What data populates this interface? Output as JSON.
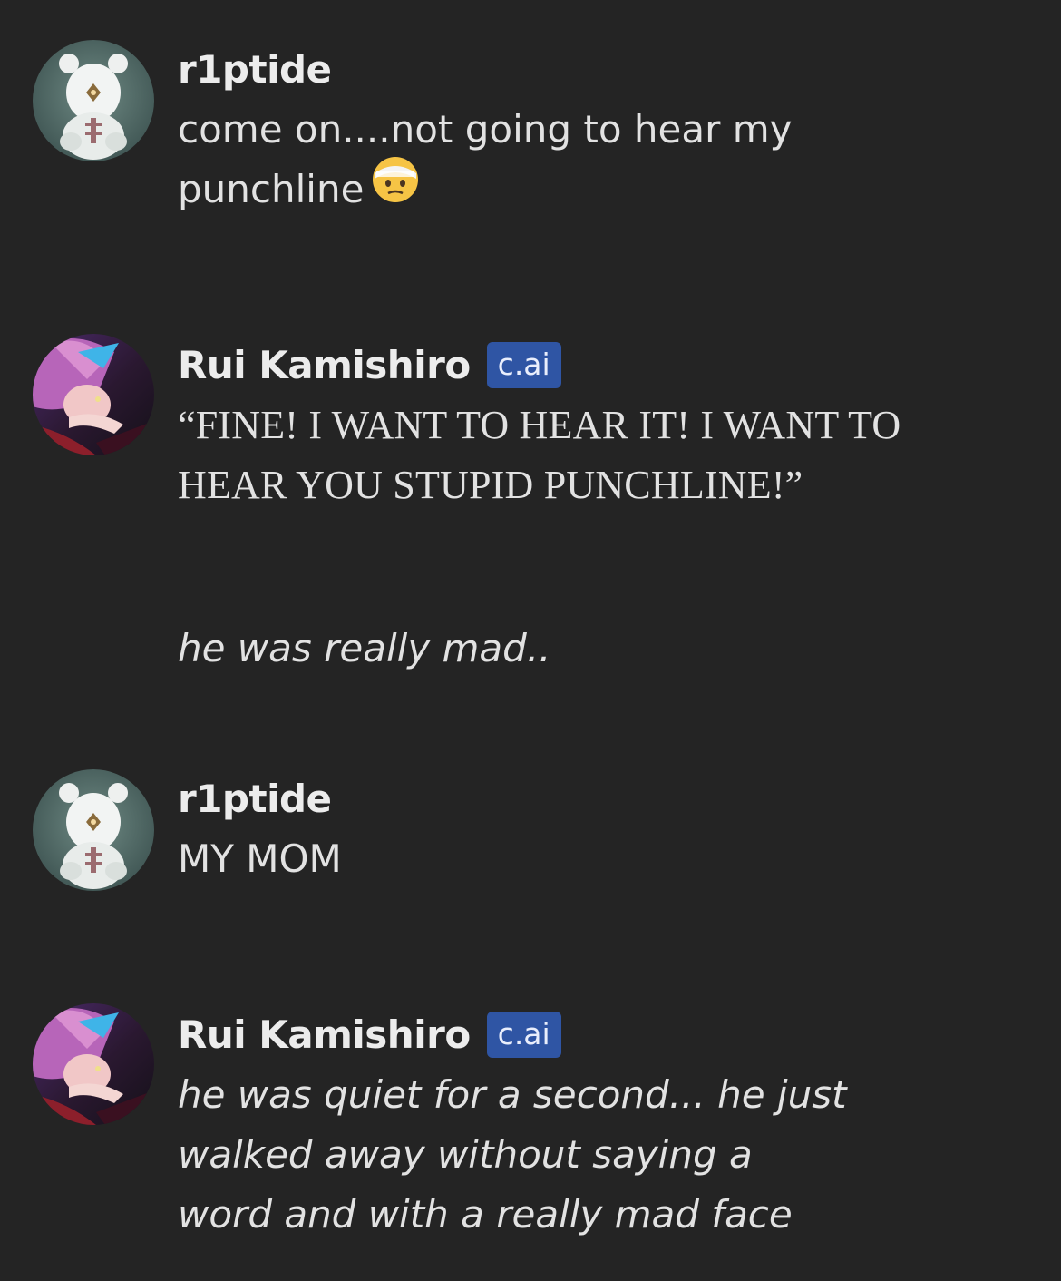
{
  "messages": [
    {
      "author": "r1ptide",
      "avatar_icon": "bear-costume-avatar-icon",
      "lines": [
        "come on....not going to hear my",
        "punchline"
      ],
      "trailing_emoji": "bandaged-head-face-emoji"
    },
    {
      "author": "Rui Kamishiro",
      "badge": "c.ai",
      "avatar_icon": "purple-hair-character-avatar-icon",
      "lines": [
        "“FINE! I WANT TO HEAR IT! I WANT TO",
        "HEAR YOU STUPID PUNCHLINE!”"
      ],
      "narration": "he was really mad.."
    },
    {
      "author": "r1ptide",
      "avatar_icon": "bear-costume-avatar-icon",
      "lines": [
        "MY MOM"
      ]
    },
    {
      "author": "Rui Kamishiro",
      "badge": "c.ai",
      "avatar_icon": "purple-hair-character-avatar-icon",
      "lines": [
        "he was quiet for a second... he just",
        "walked away without saying a",
        "word and with a really mad face"
      ]
    }
  ],
  "colors": {
    "background": "#242424",
    "badge_bg": "#2f55a4",
    "text": "#e2e2e2"
  }
}
